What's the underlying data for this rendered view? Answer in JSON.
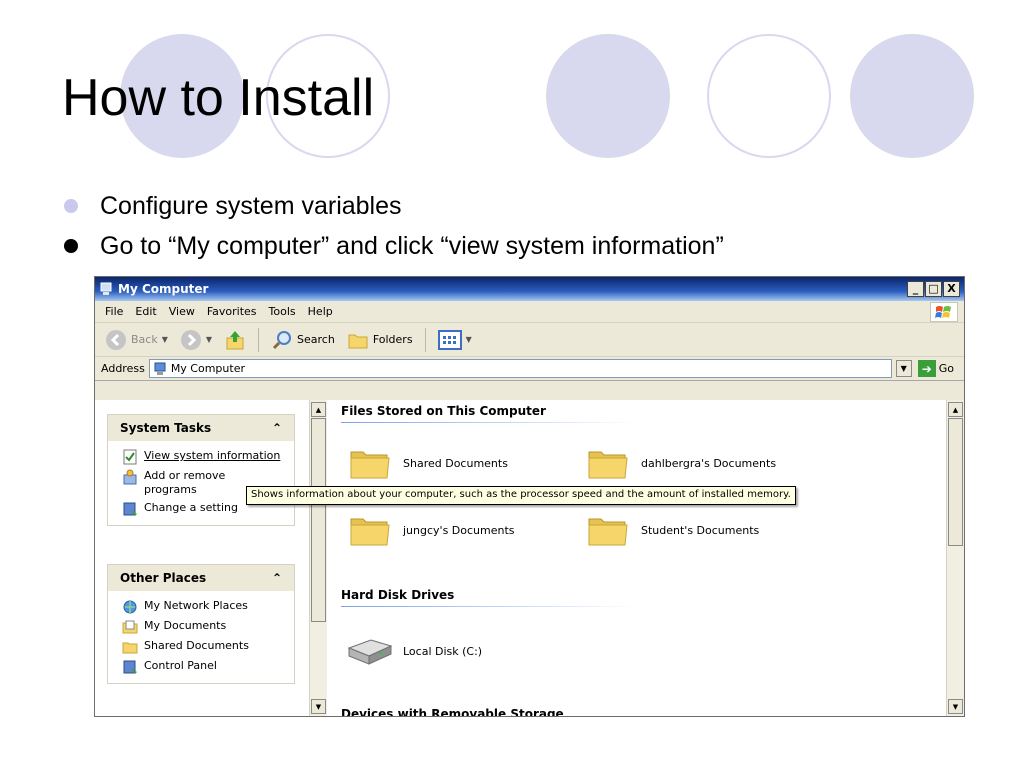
{
  "slide": {
    "title": "How to Install",
    "bullets": [
      "Configure system variables",
      "Go to “My computer” and click “view system information”"
    ]
  },
  "window": {
    "title": "My Computer",
    "controls": {
      "minimize": "_",
      "maximize": "□",
      "close": "X"
    },
    "menu": [
      "File",
      "Edit",
      "View",
      "Favorites",
      "Tools",
      "Help"
    ],
    "toolbar": {
      "back": "Back",
      "search": "Search",
      "folders": "Folders"
    },
    "address": {
      "label": "Address",
      "value": "My Computer",
      "go": "Go"
    },
    "tasks": {
      "system_tasks": {
        "title": "System Tasks",
        "items": [
          "View system information",
          "Add or remove programs",
          "Change a setting"
        ]
      },
      "other_places": {
        "title": "Other Places",
        "items": [
          "My Network Places",
          "My Documents",
          "Shared Documents",
          "Control Panel"
        ]
      }
    },
    "groups": {
      "files_stored": {
        "title": "Files Stored on This Computer",
        "items": [
          "Shared Documents",
          "dahlbergra's Documents",
          "jungcy's Documents",
          "Student's Documents"
        ]
      },
      "hard_disk": {
        "title": "Hard Disk Drives",
        "items": [
          "Local Disk (C:)"
        ]
      },
      "removable": {
        "title": "Devices with Removable Storage"
      }
    },
    "tooltip": "Shows information about your computer, such as the processor speed and the amount of installed memory."
  },
  "colors": {
    "circle": "#d8d8ee",
    "title_bar": "#0a246a",
    "folder": "#f6d66b"
  }
}
